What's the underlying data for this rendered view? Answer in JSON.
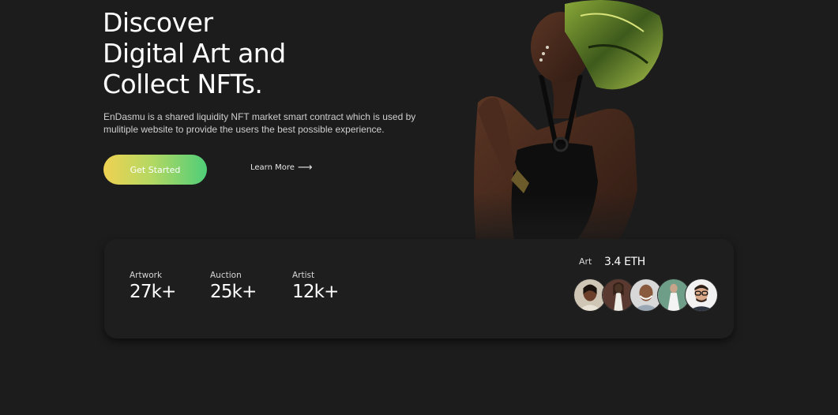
{
  "hero": {
    "title_lines": [
      "Discover",
      "Digital Art and",
      "Collect NFTs."
    ],
    "description_lines": [
      "EnDasmu is a shared liquidity NFT market smart contract which is used by",
      "mulitiple website to provide the users the best possible experience."
    ],
    "cta_label": "Get Started",
    "learn_more_label": "Learn More",
    "learn_more_icon": "arrow-right-icon",
    "accent_gradient": [
      "#efd152",
      "#4fce78"
    ]
  },
  "stats": [
    {
      "label": "Artwork",
      "value": "27k+"
    },
    {
      "label": "Auction",
      "value": "25k+"
    },
    {
      "label": "Artist",
      "value": "12k+"
    }
  ],
  "art": {
    "label": "Art",
    "price": "3.4 ETH",
    "avatars": [
      "avatar-1",
      "avatar-2",
      "avatar-3",
      "avatar-4",
      "avatar-5"
    ]
  },
  "colors": {
    "background": "#1c1c1c",
    "card": "#1e1e1e",
    "text": "#ffffff"
  }
}
